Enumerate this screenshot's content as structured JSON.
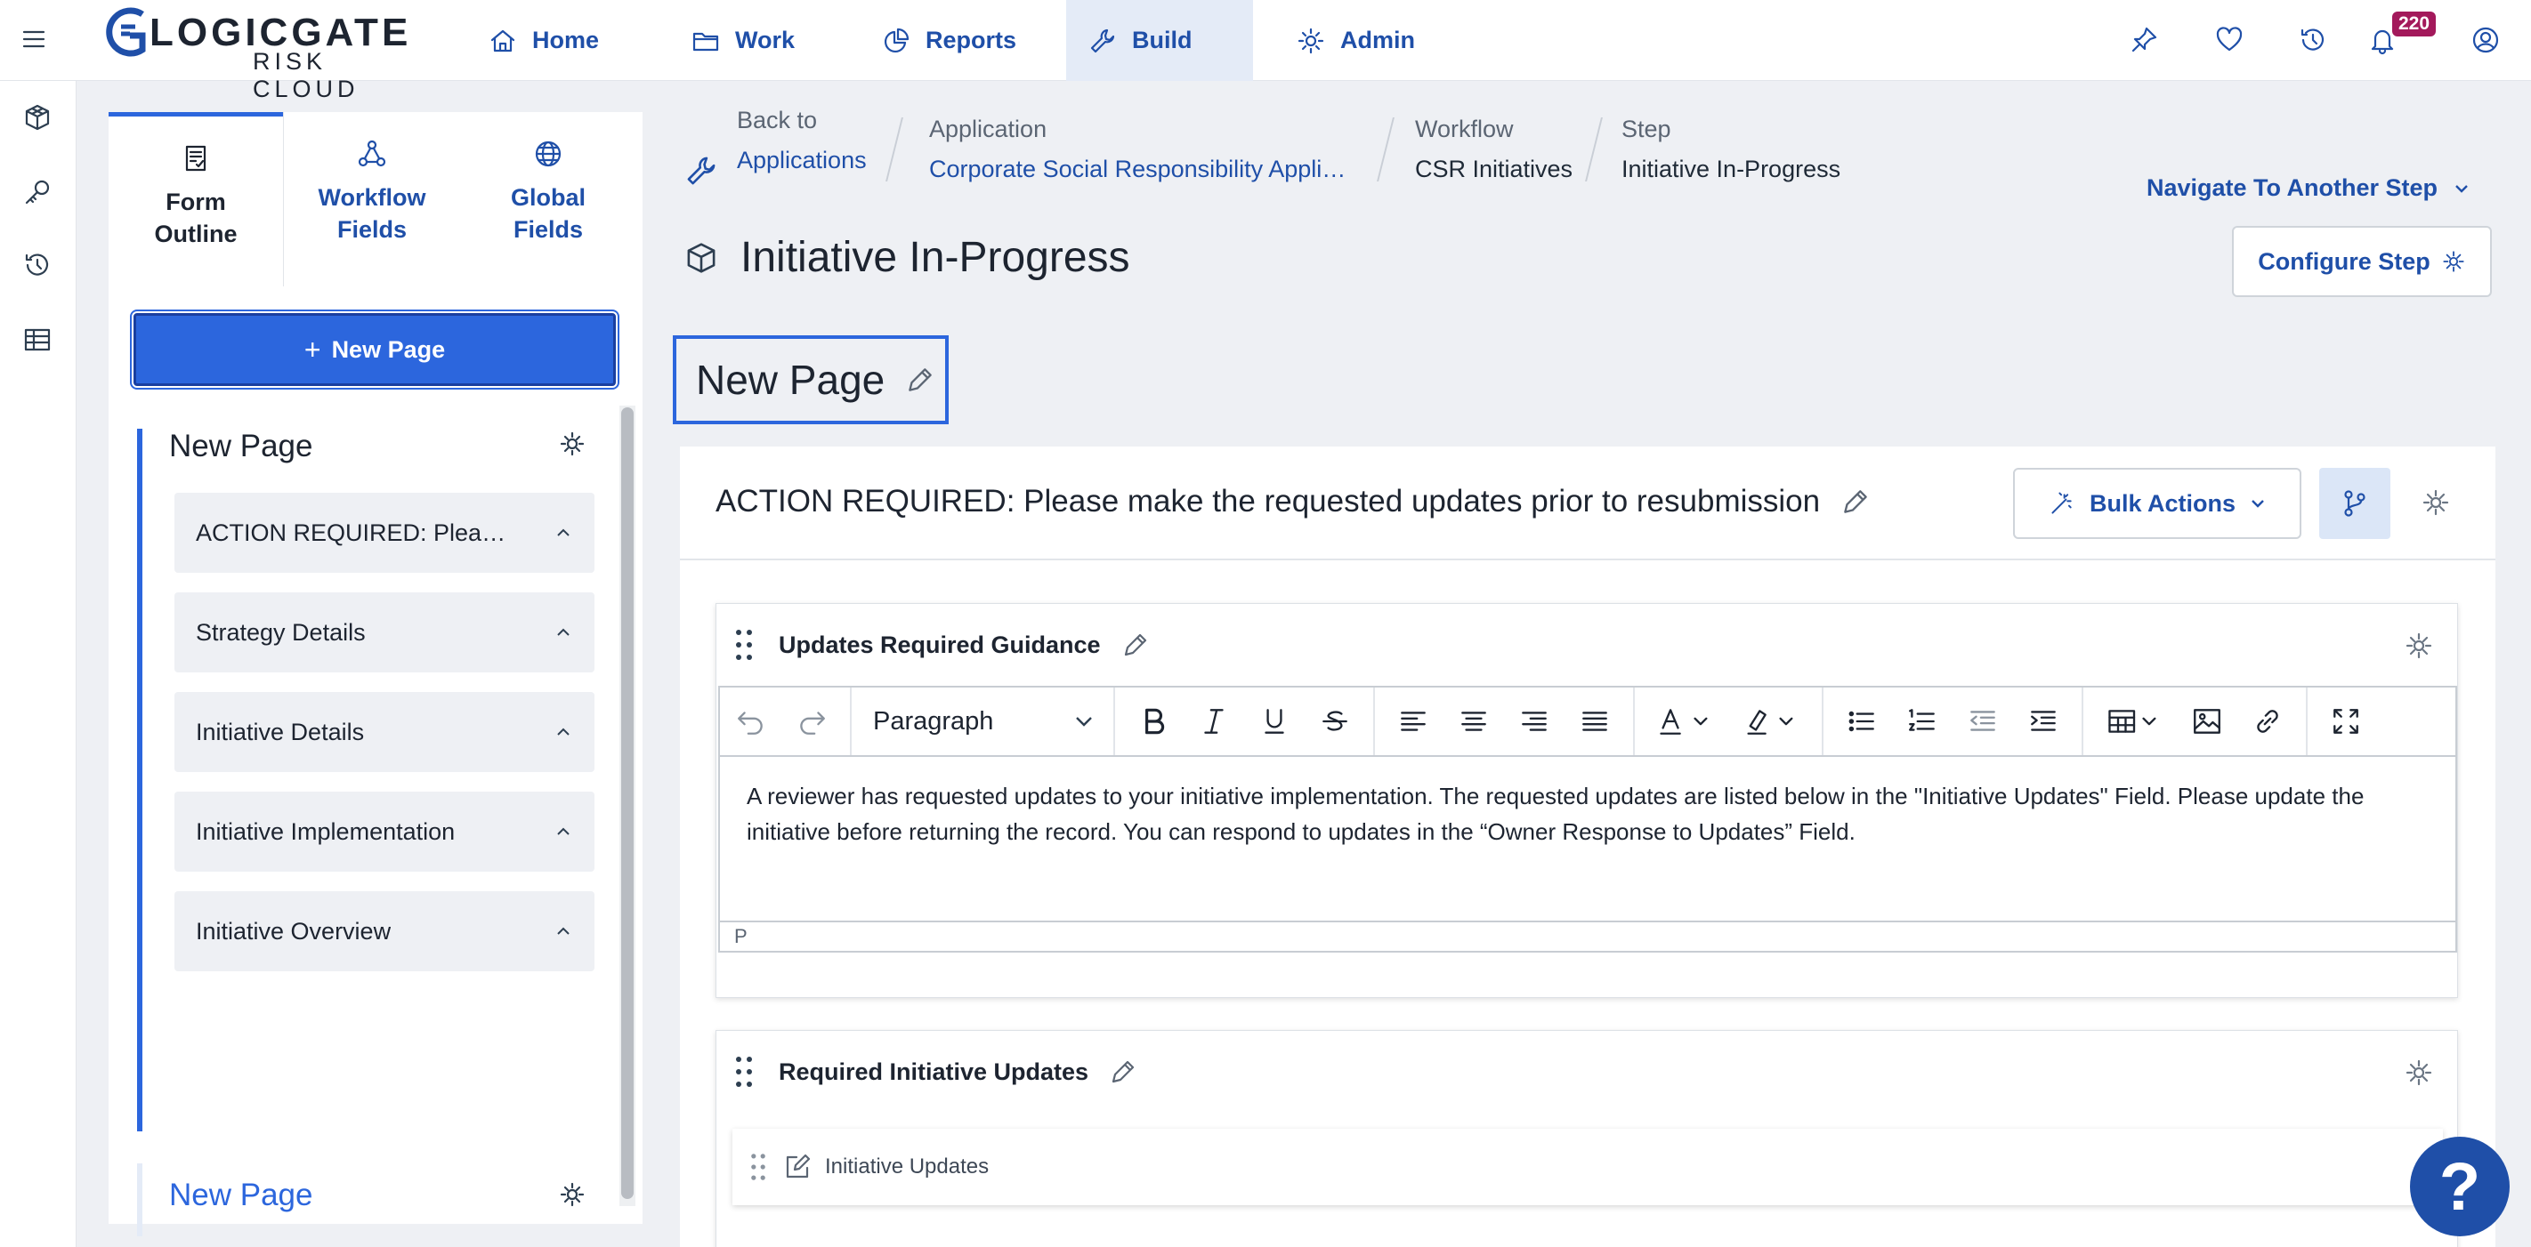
{
  "header": {
    "brand_main": "LOGICGATE",
    "brand_sub": "RISK CLOUD",
    "nav": [
      {
        "label": "Home",
        "icon": "home-icon"
      },
      {
        "label": "Work",
        "icon": "folder-icon"
      },
      {
        "label": "Reports",
        "icon": "pie-chart-icon"
      },
      {
        "label": "Build",
        "icon": "wrench-icon",
        "active": true
      },
      {
        "label": "Admin",
        "icon": "gear-icon"
      }
    ],
    "notification_count": "220",
    "icons": [
      "pin-icon",
      "heart-icon",
      "history-icon",
      "bell-icon",
      "user-icon"
    ]
  },
  "rail": {
    "icons": [
      "cube-icon",
      "key-icon",
      "history-icon",
      "table-icon"
    ]
  },
  "panel": {
    "tabs": [
      {
        "label": "Form Outline",
        "icon": "form-icon",
        "active": true
      },
      {
        "label": "Workflow Fields",
        "icon": "workflow-icon"
      },
      {
        "label": "Global Fields",
        "icon": "globe-icon"
      }
    ],
    "new_page_button": "New Page",
    "pages": [
      {
        "title": "New Page",
        "sections": [
          "ACTION REQUIRED: Please make the requested updates prior to resubmission",
          "Strategy Details",
          "Initiative Details",
          "Initiative Implementation",
          "Initiative Overview"
        ]
      },
      {
        "title": "New Page",
        "sections": []
      }
    ]
  },
  "breadcrumb": {
    "back_label": "Back to",
    "back_link": "Applications",
    "application_label": "Application",
    "application_value": "Corporate Social Responsibility Appli…",
    "workflow_label": "Workflow",
    "workflow_value": "CSR Initiatives",
    "step_label": "Step",
    "step_value": "Initiative In-Progress"
  },
  "step": {
    "title": "Initiative In-Progress",
    "navigate_label": "Navigate To Another Step",
    "configure_label": "Configure Step"
  },
  "page": {
    "heading": "New Page"
  },
  "section": {
    "title": "ACTION REQUIRED: Please make the requested updates prior to resubmission",
    "bulk_actions": "Bulk Actions"
  },
  "fields": {
    "guidance": {
      "title": "Updates Required Guidance",
      "paragraph_style": "Paragraph",
      "body": "A reviewer has requested updates to your initiative implementation. The requested updates are listed below in the \"Initiative Updates\" Field. Please update the initiative before returning the record. You can respond to updates in the “Owner Response to Updates” Field.",
      "status": "P"
    },
    "required_updates": {
      "title": "Required Initiative Updates",
      "inner_field": "Initiative Updates"
    }
  },
  "help": {
    "label": "?"
  },
  "colors": {
    "accent": "#2c66dd",
    "link": "#1f4fa8",
    "badge": "#a3195b"
  }
}
